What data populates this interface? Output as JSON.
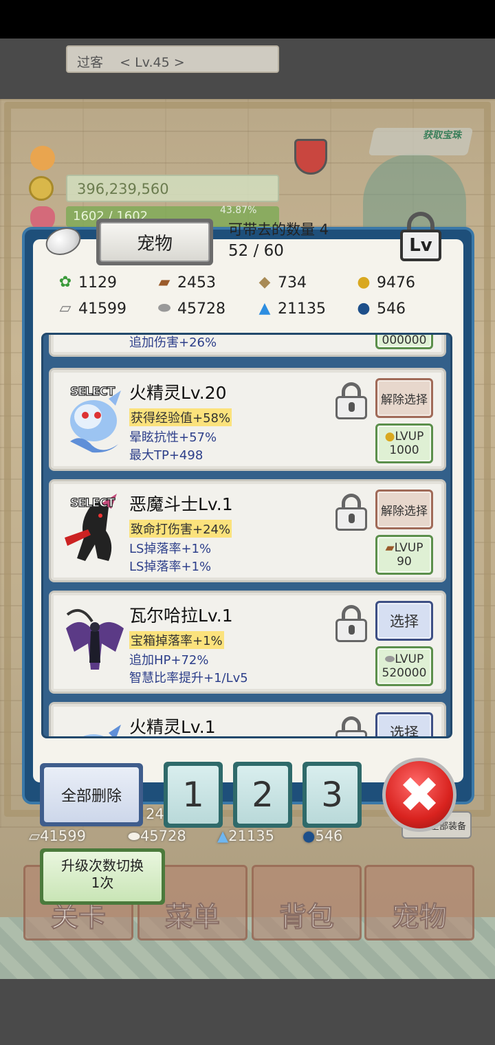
{
  "hud": {
    "player_name": "过客    < Lv.45 >",
    "gold": "396,239,560",
    "hp": "1602 / 1602",
    "exp_pct": "43.87%",
    "gem_label": "获取宝珠"
  },
  "modal": {
    "title": "宠物",
    "carry_label": "可带去的数量 4",
    "carry_count": "52 / 60",
    "lv_button": "Lv"
  },
  "resources": [
    {
      "icon": "herb-icon",
      "value": "1129"
    },
    {
      "icon": "wood-log-icon",
      "value": "2453"
    },
    {
      "icon": "plank-icon",
      "value": "734"
    },
    {
      "icon": "oil-drop-icon",
      "value": "9476"
    },
    {
      "icon": "iron-bar-icon",
      "value": "41599"
    },
    {
      "icon": "stone-icon",
      "value": "45728"
    },
    {
      "icon": "blue-flame-icon",
      "value": "21135"
    },
    {
      "icon": "blue-orb-icon",
      "value": "546"
    }
  ],
  "pets": [
    {
      "partial_top_line": "追加伤害+26%",
      "partial_lv_value": "000000"
    },
    {
      "selected": "SELECT",
      "name": "火精灵Lv.20",
      "stat1": "获得经验值+58%",
      "stat2": "晕眩抗性+57%",
      "stat3": "最大TP+498",
      "select_btn": "解除选择",
      "lvup_label": "LVUP",
      "lvup_cost": "1000",
      "lvup_icon": "oil-drop-icon"
    },
    {
      "selected": "SELECT",
      "name": "恶魔斗士Lv.1",
      "stat1": "致命打伤害+24%",
      "stat2": "LS掉落率+1%",
      "stat3": "LS掉落率+1%",
      "select_btn": "解除选择",
      "lvup_label": "LVUP",
      "lvup_cost": "90",
      "lvup_icon": "wood-log-icon"
    },
    {
      "name": "瓦尔哈拉Lv.1",
      "stat1": "宝箱掉落率+1%",
      "stat2": "追加HP+72%",
      "stat3": "智慧比率提升+1/Lv5",
      "select_btn": "选择",
      "lvup_label": "LVUP",
      "lvup_cost": "520000",
      "lvup_icon": "stone-icon"
    },
    {
      "name": "火精灵Lv.1",
      "select_btn": "选择"
    }
  ],
  "buttons": {
    "delete_all": "全部删除",
    "slot1": "1",
    "slot2": "2",
    "slot3": "3",
    "close": "✖",
    "upgrade_line1": "升级次数切换",
    "upgrade_line2": "1次",
    "all_equip": "全部装备"
  },
  "under_resources": {
    "partial": "24",
    "iron": "41599",
    "stone": "45728",
    "flame": "21135",
    "orb": "546"
  },
  "nav": [
    "关卡",
    "菜单",
    "背包",
    "宠物"
  ],
  "colors": {
    "modal_frame": "#1e4f7a",
    "highlight_stat": "#fbe27c",
    "blue_stat": "#2d3f8a",
    "close_red": "#d9231f"
  }
}
